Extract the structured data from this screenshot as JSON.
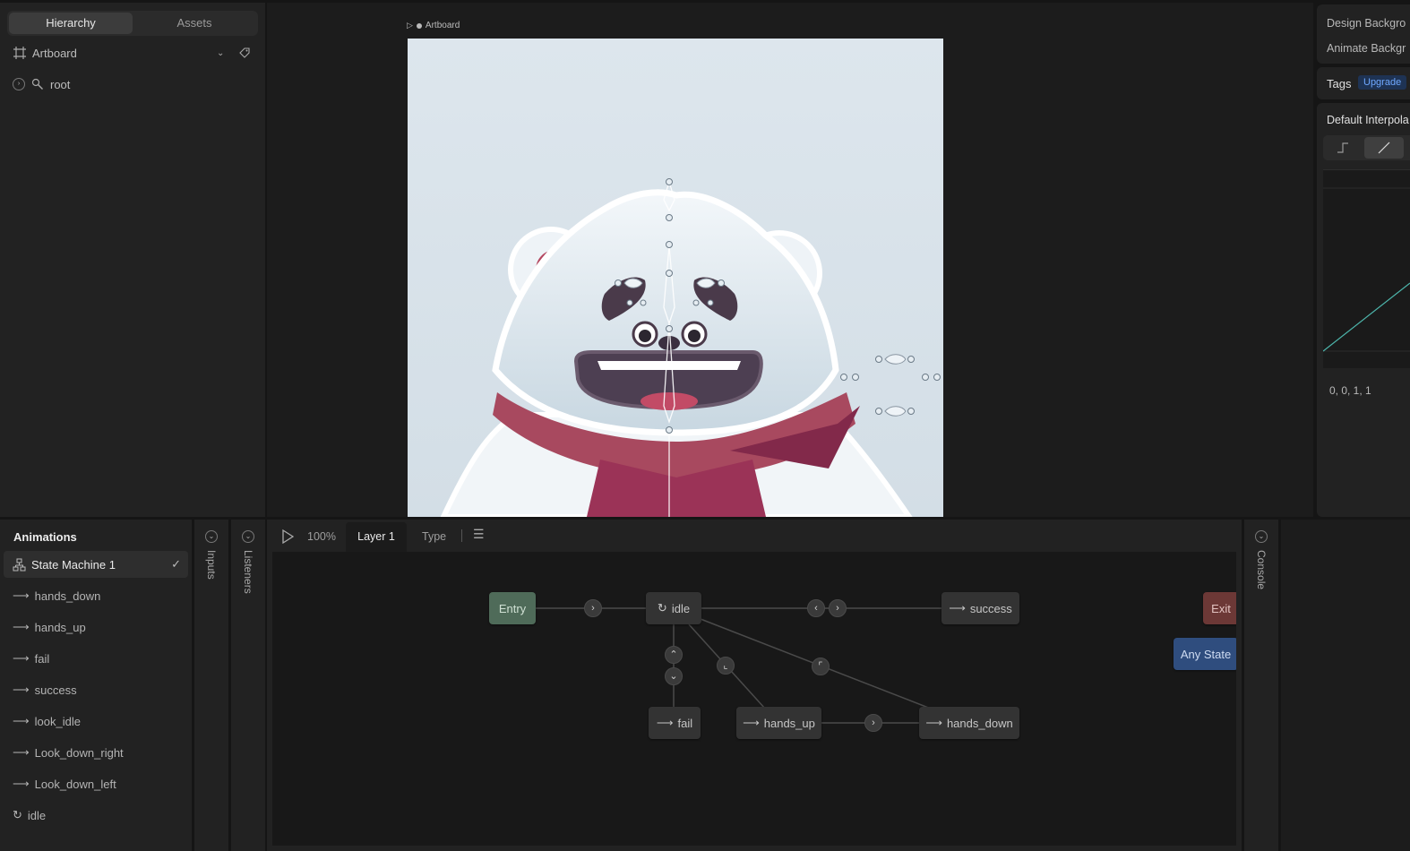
{
  "hierarchy": {
    "tabs": [
      "Hierarchy",
      "Assets"
    ],
    "artboard_label": "Artboard",
    "root_label": "root"
  },
  "canvas": {
    "artboard_title": "Artboard"
  },
  "right_panel": {
    "design_bg": "Design Backgro",
    "animate_bg": "Animate Backgr",
    "tags_label": "Tags",
    "upgrade_label": "Upgrade",
    "interp_label": "Default Interpola",
    "curve_values": "0, 0, 1, 1"
  },
  "animations": {
    "header": "Animations",
    "items": [
      {
        "label": "State Machine 1",
        "icon": "state-machine-icon"
      },
      {
        "label": "hands_down",
        "icon": "arrow-icon"
      },
      {
        "label": "hands_up",
        "icon": "arrow-icon"
      },
      {
        "label": "fail",
        "icon": "arrow-icon"
      },
      {
        "label": "success",
        "icon": "arrow-icon"
      },
      {
        "label": "look_idle",
        "icon": "arrow-icon"
      },
      {
        "label": "Look_down_right",
        "icon": "arrow-icon"
      },
      {
        "label": "Look_down_left",
        "icon": "arrow-icon"
      },
      {
        "label": "idle",
        "icon": "loop-icon"
      }
    ]
  },
  "side_tabs": {
    "inputs": "Inputs",
    "listeners": "Listeners",
    "console": "Console"
  },
  "state_machine": {
    "zoom": "100%",
    "layer_tab": "Layer 1",
    "type_tab": "Type",
    "nodes": {
      "entry": "Entry",
      "idle": "idle",
      "success": "success",
      "exit": "Exit",
      "any_state": "Any State",
      "fail": "fail",
      "hands_up": "hands_up",
      "hands_down": "hands_down"
    }
  },
  "colors": {
    "accent_upgrade": "#3b82f6",
    "curve": "#4db6ac",
    "entry": "#4f6b59",
    "exit": "#6c3836",
    "any_state": "#2f4d7e"
  }
}
